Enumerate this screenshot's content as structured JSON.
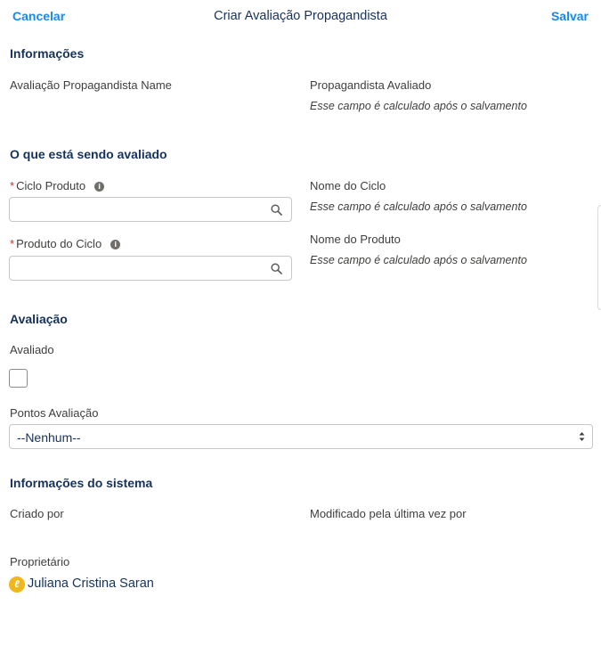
{
  "header": {
    "cancel_label": "Cancelar",
    "title": "Criar Avaliação Propagandista",
    "save_label": "Salvar"
  },
  "sections": {
    "informacoes": {
      "title": "Informações",
      "name_label": "Avaliação Propagandista Name",
      "avaliado_label": "Propagandista Avaliado",
      "avaliado_calc": "Esse campo é calculado após o salvamento"
    },
    "avaliado": {
      "title": "O que está sendo avaliado",
      "ciclo_produto_label": "Ciclo Produto",
      "ciclo_produto_value": "",
      "produto_ciclo_label": "Produto do Ciclo",
      "produto_ciclo_value": "",
      "nome_ciclo_label": "Nome do Ciclo",
      "nome_ciclo_calc": "Esse campo é calculado após o salvamento",
      "nome_produto_label": "Nome do Produto",
      "nome_produto_calc": "Esse campo é calculado após o salvamento"
    },
    "avaliacao": {
      "title": "Avaliação",
      "avaliado_label": "Avaliado",
      "avaliado_checked": false,
      "pontos_label": "Pontos Avaliação",
      "pontos_selected": "--Nenhum--"
    },
    "sistema": {
      "title": "Informações do sistema",
      "criado_por_label": "Criado por",
      "modificado_label": "Modificado pela última vez por",
      "proprietario_label": "Proprietário",
      "owner_name": "Juliana Cristina Saran"
    }
  },
  "icons": {
    "search": "search-icon",
    "info": "info-icon",
    "select_arrows": "updown-arrows-icon",
    "owner_avatar": "user-avatar-icon"
  },
  "colors": {
    "link": "#1589ee",
    "required": "#c23934",
    "avatar": "#f0b71a"
  }
}
